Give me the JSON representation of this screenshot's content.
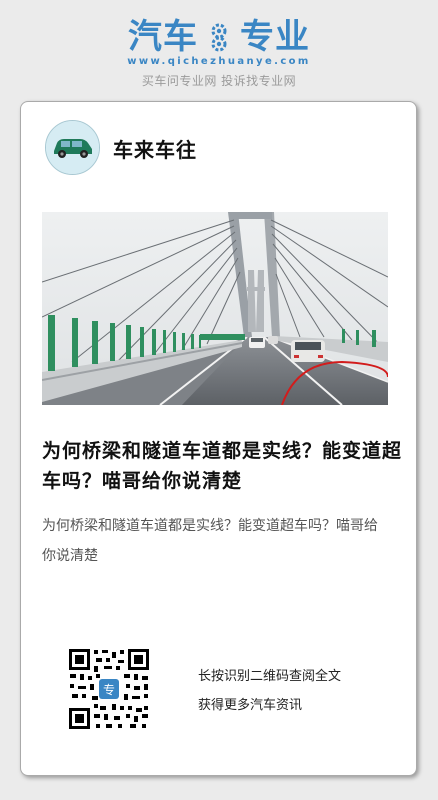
{
  "header": {
    "logo_left": "汽车",
    "logo_right": "专业",
    "domain": "www.qichezhuanye.com",
    "slogan": "买车问专业网 投诉找专业网"
  },
  "article": {
    "author": "车来车往",
    "avatar_icon": "green-car-icon",
    "title": "为何桥梁和隧道车道都是实线？能变道超车吗？喵哥给你说清楚",
    "summary": "为何桥梁和隧道车道都是实线？能变道超车吗？喵哥给你说清楚",
    "cover_image": "cable-stayed-bridge-photo"
  },
  "qr": {
    "icon": "qr-code-icon",
    "line1": "长按识别二维码查阅全文",
    "line2": "获得更多汽车资讯"
  },
  "colors": {
    "brand_blue": "#3a86c4",
    "background": "#ebebeb",
    "card": "#ffffff"
  }
}
